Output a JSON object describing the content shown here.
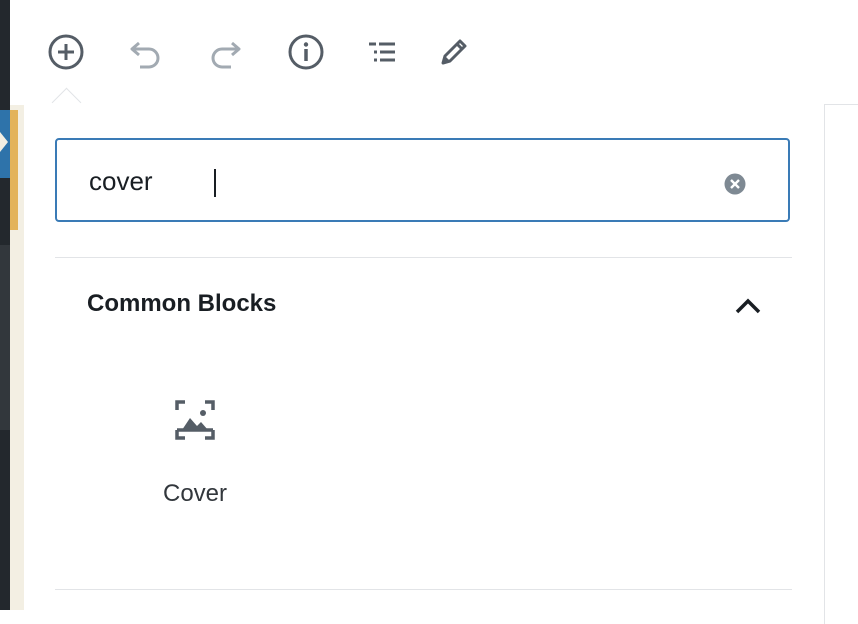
{
  "toolbar": {
    "buttons": [
      {
        "name": "add-block-button",
        "icon": "plus-circle-icon"
      },
      {
        "name": "undo-button",
        "icon": "undo-icon"
      },
      {
        "name": "redo-button",
        "icon": "redo-icon"
      },
      {
        "name": "content-info-button",
        "icon": "info-icon"
      },
      {
        "name": "block-navigation-button",
        "icon": "list-icon"
      },
      {
        "name": "tools-button",
        "icon": "pencil-icon"
      }
    ]
  },
  "inserter": {
    "search": {
      "value": "cover",
      "placeholder": "Search for a block"
    },
    "panel": {
      "title": "Common Blocks",
      "expanded": true,
      "items": [
        {
          "label": "Cover",
          "icon": "cover-image-icon"
        }
      ]
    }
  },
  "colors": {
    "accent": "#3a7bb6",
    "icon": "#555d66",
    "icon_disabled": "#a2aab2",
    "text": "#191e23"
  }
}
